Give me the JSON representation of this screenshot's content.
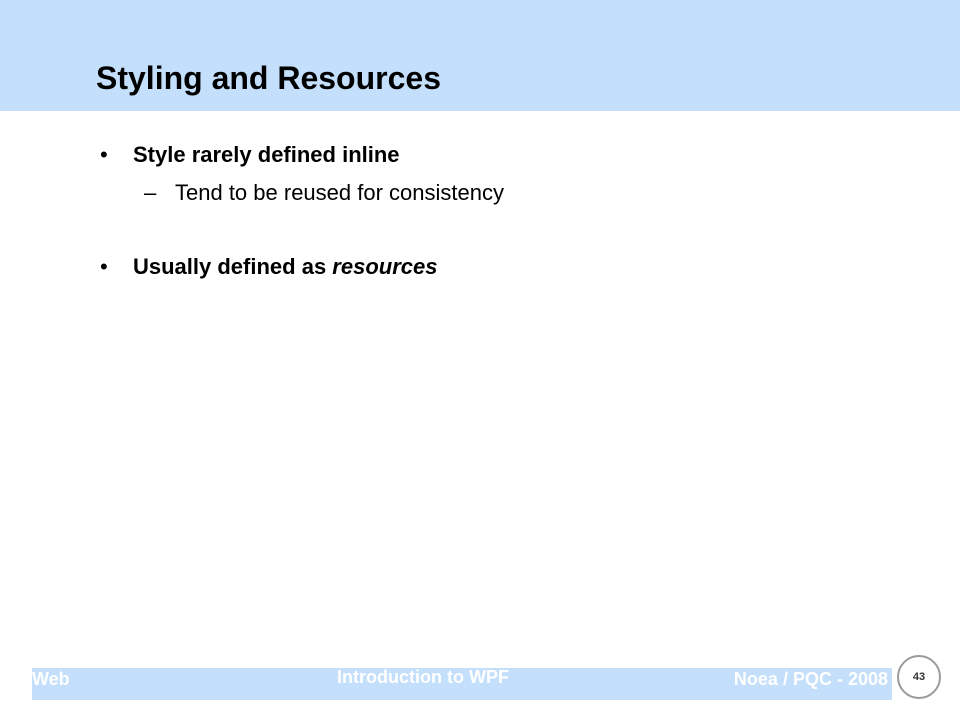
{
  "slide": {
    "title": "Styling and Resources",
    "bullets": [
      {
        "text": "Style rarely defined inline",
        "sub": [
          "Tend to be reused for consistency"
        ]
      },
      {
        "text_prefix": "Usually defined as ",
        "text_emphasis": "resources"
      }
    ]
  },
  "footer": {
    "left": "Web",
    "center": "Introduction to WPF",
    "right": "Noea / PQC - 2008",
    "page_number": "43"
  },
  "colors": {
    "band": "#c3dffb",
    "footer_text": "#ffffff",
    "text": "#000000"
  }
}
